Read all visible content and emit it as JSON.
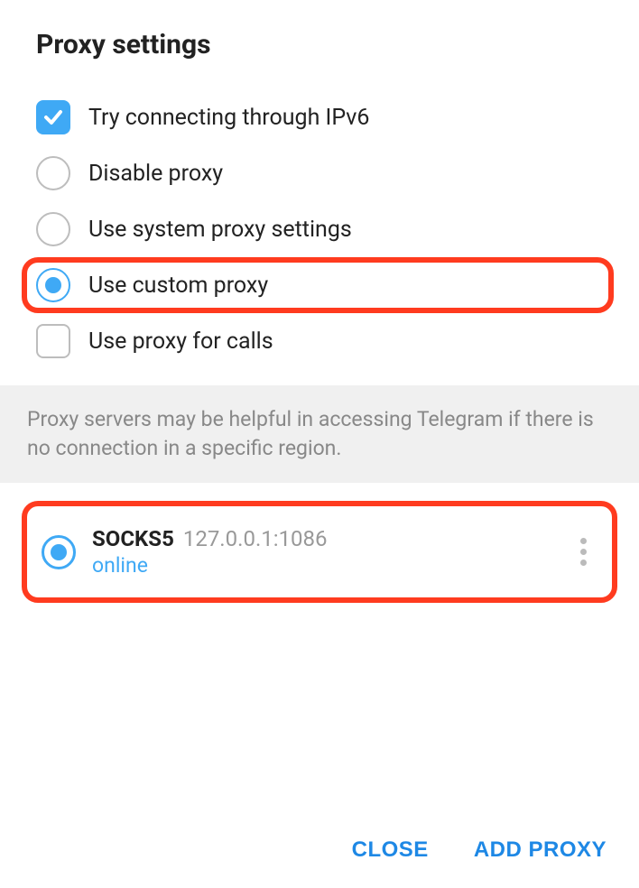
{
  "title": "Proxy settings",
  "options": {
    "ipv6": {
      "label": "Try connecting through IPv6",
      "checked": true
    },
    "disable": {
      "label": "Disable proxy",
      "selected": false
    },
    "system": {
      "label": "Use system proxy settings",
      "selected": false
    },
    "custom": {
      "label": "Use custom proxy",
      "selected": true
    },
    "calls": {
      "label": "Use proxy for calls",
      "checked": false
    }
  },
  "info": "Proxy servers may be helpful in accessing Telegram if there is no connection in a specific region.",
  "proxies": [
    {
      "type": "SOCKS5",
      "address": "127.0.0.1:1086",
      "status": "online",
      "selected": true
    }
  ],
  "footer": {
    "close": "CLOSE",
    "add": "ADD PROXY"
  }
}
